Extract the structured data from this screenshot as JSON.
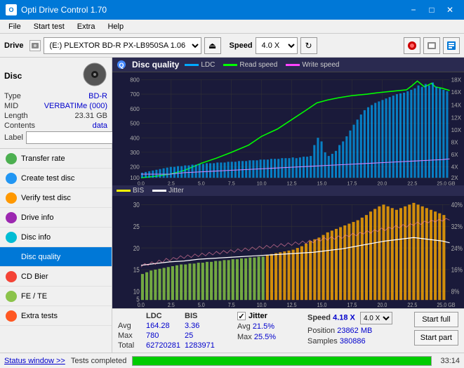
{
  "titlebar": {
    "icon_text": "O",
    "title": "Opti Drive Control 1.70",
    "min_label": "−",
    "max_label": "□",
    "close_label": "✕"
  },
  "menubar": {
    "items": [
      "File",
      "Start test",
      "Extra",
      "Help"
    ]
  },
  "toolbar": {
    "drive_label": "Drive",
    "drive_option": "(E:)  PLEXTOR BD-R  PX-LB950SA 1.06",
    "speed_label": "Speed",
    "speed_option": "4.0 X"
  },
  "disc": {
    "title": "Disc",
    "type_label": "Type",
    "type_val": "BD-R",
    "mid_label": "MID",
    "mid_val": "VERBATIMe (000)",
    "length_label": "Length",
    "length_val": "23.31 GB",
    "contents_label": "Contents",
    "contents_val": "data",
    "label_label": "Label",
    "label_placeholder": ""
  },
  "nav": {
    "items": [
      {
        "id": "transfer-rate",
        "label": "Transfer rate",
        "active": false
      },
      {
        "id": "create-test-disc",
        "label": "Create test disc",
        "active": false
      },
      {
        "id": "verify-test-disc",
        "label": "Verify test disc",
        "active": false
      },
      {
        "id": "drive-info",
        "label": "Drive info",
        "active": false
      },
      {
        "id": "disc-info",
        "label": "Disc info",
        "active": false
      },
      {
        "id": "disc-quality",
        "label": "Disc quality",
        "active": true
      },
      {
        "id": "cd-bier",
        "label": "CD Bier",
        "active": false
      },
      {
        "id": "fe-te",
        "label": "FE / TE",
        "active": false
      },
      {
        "id": "extra-tests",
        "label": "Extra tests",
        "active": false
      }
    ]
  },
  "chart": {
    "title": "Disc quality",
    "top_legend": [
      {
        "label": "LDC",
        "color": "#00aaff"
      },
      {
        "label": "Read speed",
        "color": "#00ff00"
      },
      {
        "label": "Write speed",
        "color": "#ff00ff"
      }
    ],
    "top_y_left_max": "800",
    "top_y_left_labels": [
      "800",
      "700",
      "600",
      "500",
      "400",
      "300",
      "200",
      "100"
    ],
    "top_y_right_labels": [
      "18X",
      "16X",
      "14X",
      "12X",
      "10X",
      "8X",
      "6X",
      "4X",
      "2X"
    ],
    "top_x_labels": [
      "0.0",
      "2.5",
      "5.0",
      "7.5",
      "10.0",
      "12.5",
      "15.0",
      "17.5",
      "20.0",
      "22.5",
      "25.0 GB"
    ],
    "bottom_legend": [
      {
        "label": "BIS",
        "color": "#ffff00"
      },
      {
        "label": "Jitter",
        "color": "#ffffff"
      }
    ],
    "bottom_y_left_labels": [
      "30",
      "25",
      "20",
      "15",
      "10",
      "5"
    ],
    "bottom_y_right_labels": [
      "40%",
      "32%",
      "24%",
      "16%",
      "8%"
    ],
    "bottom_x_labels": [
      "0.0",
      "2.5",
      "5.0",
      "7.5",
      "10.0",
      "12.5",
      "15.0",
      "17.5",
      "20.0",
      "22.5",
      "25.0 GB"
    ]
  },
  "stats": {
    "col_headers": [
      "",
      "LDC",
      "BIS"
    ],
    "rows": [
      {
        "label": "Avg",
        "ldc": "164.28",
        "bis": "3.36"
      },
      {
        "label": "Max",
        "ldc": "780",
        "bis": "25"
      },
      {
        "label": "Total",
        "ldc": "62720281",
        "bis": "1283971"
      }
    ],
    "jitter_label": "Jitter",
    "jitter_checked": true,
    "jitter_avg": "21.5%",
    "jitter_max": "25.5%",
    "speed_label": "Speed",
    "speed_val": "4.18 X",
    "speed_select": "4.0 X",
    "position_label": "Position",
    "position_val": "23862 MB",
    "samples_label": "Samples",
    "samples_val": "380886",
    "btn_full": "Start full",
    "btn_part": "Start part"
  },
  "statusbar": {
    "status_window": "Status window >>",
    "status_text": "Tests completed",
    "progress_pct": 100,
    "time": "33:14"
  }
}
